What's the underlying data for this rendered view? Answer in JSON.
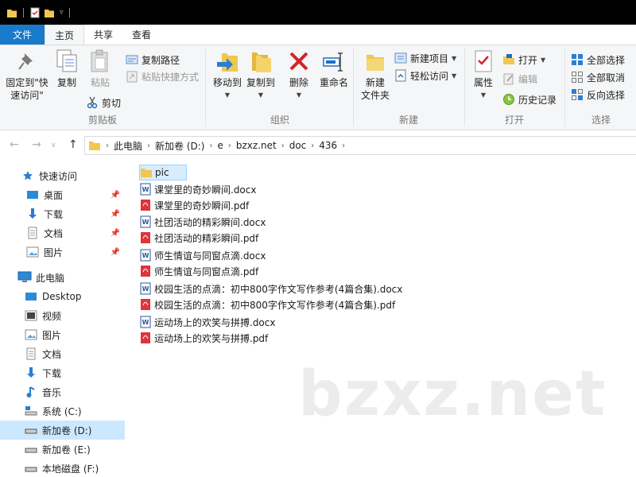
{
  "ribbon_tabs": [
    "文件",
    "主页",
    "共享",
    "查看"
  ],
  "ribbon": {
    "clipboard": {
      "pin_label_1": "固定到\"快",
      "pin_label_2": "速访问\"",
      "copy": "复制",
      "paste": "粘贴",
      "copy_path": "复制路径",
      "paste_shortcut": "粘贴快捷方式",
      "cut": "剪切",
      "group": "剪贴板"
    },
    "organize": {
      "move_to": "移动到",
      "copy_to": "复制到",
      "delete": "删除",
      "rename": "重命名",
      "group": "组织"
    },
    "new": {
      "new_folder_1": "新建",
      "new_folder_2": "文件夹",
      "new_item": "新建项目",
      "easy_access": "轻松访问",
      "group": "新建"
    },
    "open": {
      "properties": "属性",
      "open": "打开",
      "edit": "编辑",
      "history": "历史记录",
      "group": "打开"
    },
    "select": {
      "select_all": "全部选择",
      "select_none": "全部取消",
      "invert": "反向选择",
      "group": "选择"
    }
  },
  "breadcrumb": [
    "此电脑",
    "新加卷 (D:)",
    "e",
    "bzxz.net",
    "doc",
    "436"
  ],
  "nav": {
    "quick_access": "快速访问",
    "quick_items": [
      "桌面",
      "下载",
      "文档",
      "图片"
    ],
    "this_pc": "此电脑",
    "pc_items": [
      "Desktop",
      "视频",
      "图片",
      "文档",
      "下载",
      "音乐",
      "系统 (C:)",
      "新加卷 (D:)",
      "新加卷 (E:)",
      "本地磁盘 (F:)"
    ]
  },
  "files": [
    {
      "name": "pic",
      "type": "folder"
    },
    {
      "name": "课堂里的奇妙瞬间.docx",
      "type": "docx"
    },
    {
      "name": "课堂里的奇妙瞬间.pdf",
      "type": "pdf"
    },
    {
      "name": "社团活动的精彩瞬间.docx",
      "type": "docx"
    },
    {
      "name": "社团活动的精彩瞬间.pdf",
      "type": "pdf"
    },
    {
      "name": "师生情谊与同窗点滴.docx",
      "type": "docx"
    },
    {
      "name": "师生情谊与同窗点滴.pdf",
      "type": "pdf"
    },
    {
      "name": "校园生活的点滴：初中800字作文写作参考(4篇合集).docx",
      "type": "docx"
    },
    {
      "name": "校园生活的点滴：初中800字作文写作参考(4篇合集).pdf",
      "type": "pdf"
    },
    {
      "name": "运动场上的欢笑与拼搏.docx",
      "type": "docx"
    },
    {
      "name": "运动场上的欢笑与拼搏.pdf",
      "type": "pdf"
    }
  ],
  "watermark": "bzxz.net"
}
